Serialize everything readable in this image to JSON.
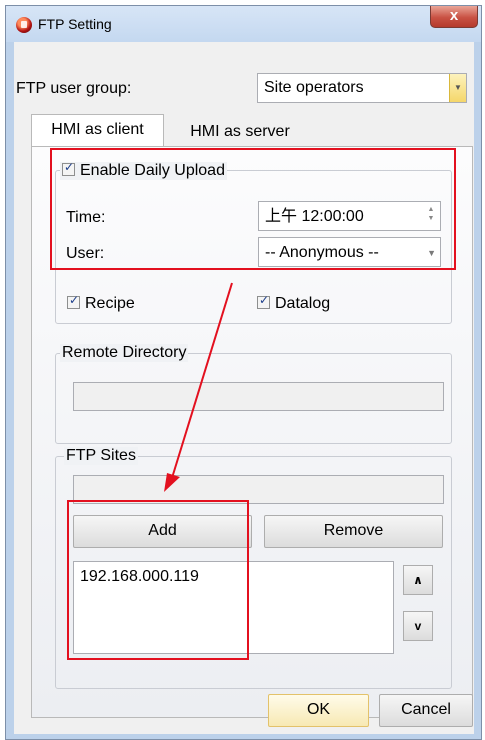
{
  "window": {
    "title": "FTP Setting",
    "close_glyph": "x"
  },
  "user_group": {
    "label": "FTP user group:",
    "value": "Site operators"
  },
  "tabs": [
    {
      "label": "HMI as client",
      "active": true
    },
    {
      "label": "HMI as server",
      "active": false
    }
  ],
  "daily_upload": {
    "checkbox_label": "Enable Daily Upload",
    "checked": true,
    "time_label": "Time:",
    "time_value": "上午 12:00:00",
    "user_label": "User:",
    "user_value": "-- Anonymous --"
  },
  "options": [
    {
      "label": "Recipe",
      "checked": true
    },
    {
      "label": "Datalog",
      "checked": true
    }
  ],
  "remote_directory": {
    "legend": "Remote Directory",
    "value": ""
  },
  "ftp_sites": {
    "legend": "FTP Sites",
    "input_value": "",
    "add_label": "Add",
    "remove_label": "Remove",
    "items": [
      "192.168.000.119"
    ],
    "up_label": "∧",
    "down_label": "v"
  },
  "footer": {
    "ok_label": "OK",
    "cancel_label": "Cancel"
  },
  "colors": {
    "annotation": "#e3101f",
    "titlebar": "#c4d8f0",
    "close": "#c95143"
  },
  "icons": {
    "app": "app-logo-icon",
    "close": "close-icon"
  }
}
